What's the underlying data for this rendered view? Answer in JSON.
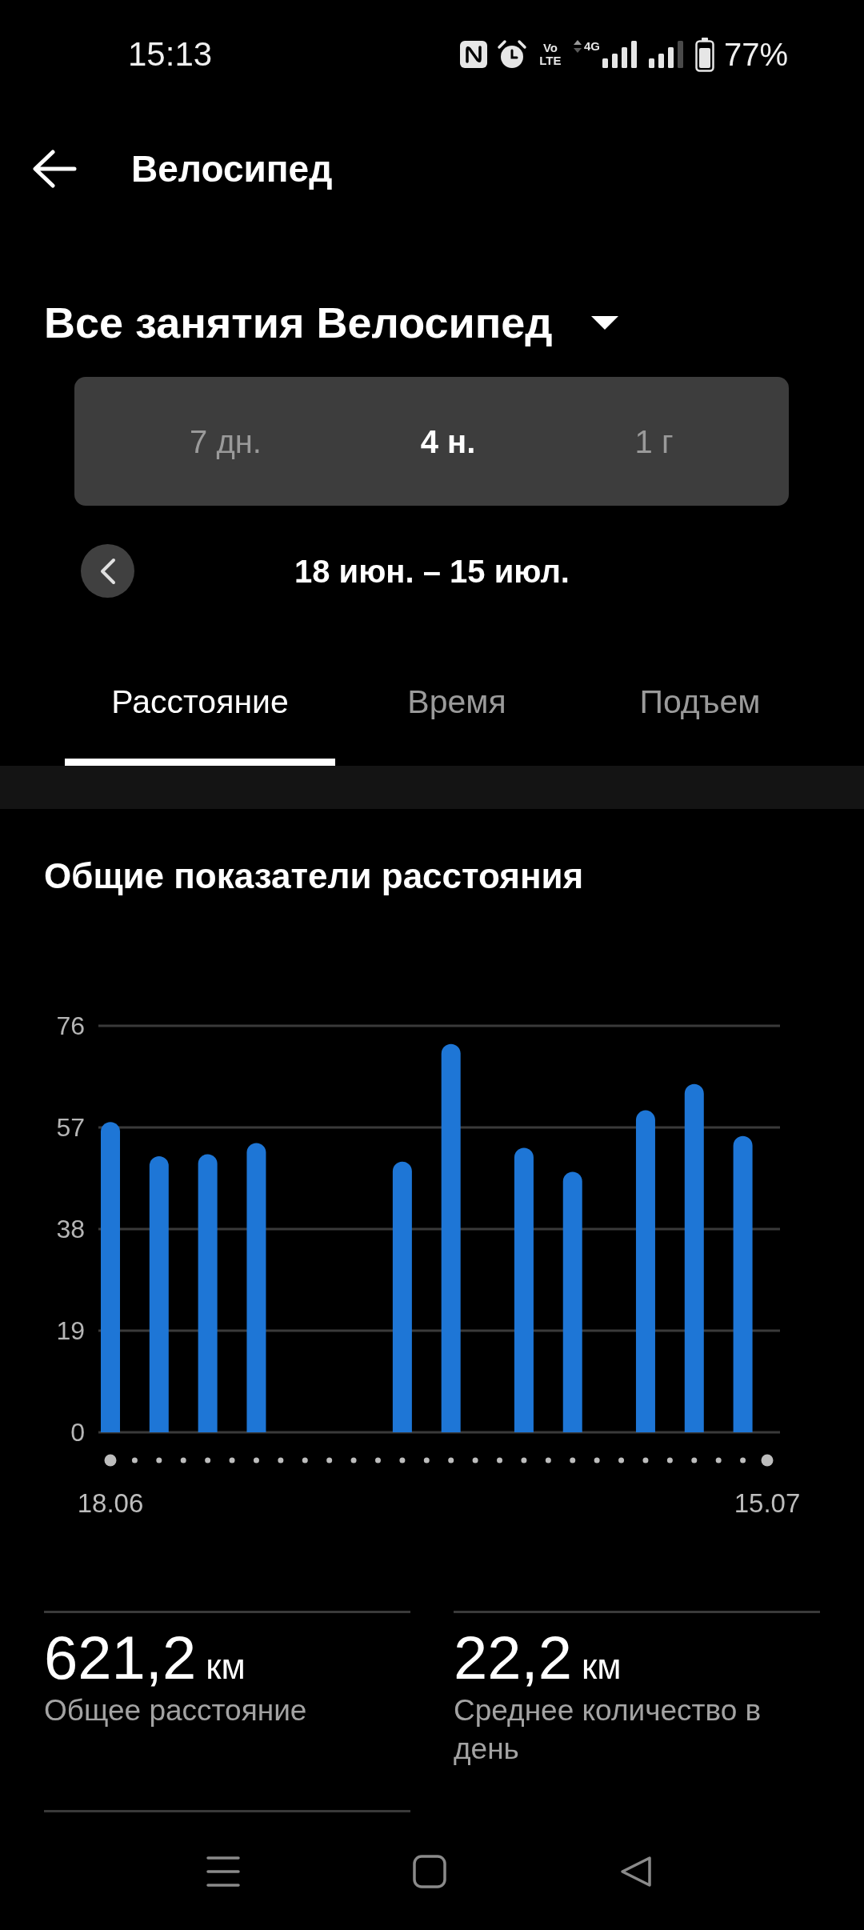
{
  "status_bar": {
    "time": "15:13",
    "volte": "Vo LTE",
    "network": "4G",
    "battery": "77%"
  },
  "header": {
    "title": "Велосипед"
  },
  "activity_filter": {
    "label": "Все занятия Велосипед"
  },
  "period_selector": [
    {
      "label": "7 дн.",
      "selected": false
    },
    {
      "label": "4 н.",
      "selected": true
    },
    {
      "label": "1 г",
      "selected": false
    }
  ],
  "date_range": {
    "label": "18 июн. – 15 июл."
  },
  "metric_tabs": [
    {
      "label": "Расстояние",
      "selected": true
    },
    {
      "label": "Время",
      "selected": false
    },
    {
      "label": "Подъем",
      "selected": false
    }
  ],
  "chart_section": {
    "title": "Общие показатели расстояния",
    "chart_data": {
      "type": "bar",
      "grid": true,
      "categories": [
        "18.06",
        null,
        null,
        null,
        null,
        null,
        null,
        null,
        null,
        null,
        null,
        null,
        null,
        null,
        null,
        null,
        null,
        null,
        null,
        null,
        null,
        null,
        null,
        null,
        null,
        null,
        null,
        "15.07"
      ],
      "values": [
        58.0,
        null,
        51.6,
        null,
        52.0,
        null,
        54.1,
        null,
        null,
        null,
        null,
        null,
        50.6,
        null,
        72.6,
        null,
        null,
        53.2,
        null,
        48.7,
        null,
        null,
        60.2,
        null,
        65.1,
        null,
        55.4,
        null
      ],
      "ylim": [
        0,
        76
      ],
      "yticks": [
        0,
        19,
        38,
        57,
        76
      ]
    }
  },
  "stats": [
    {
      "value": "621,2",
      "unit": "км",
      "label": "Общее расстояние"
    },
    {
      "value": "22,2",
      "unit": "км",
      "label": "Среднее количество в день"
    }
  ]
}
